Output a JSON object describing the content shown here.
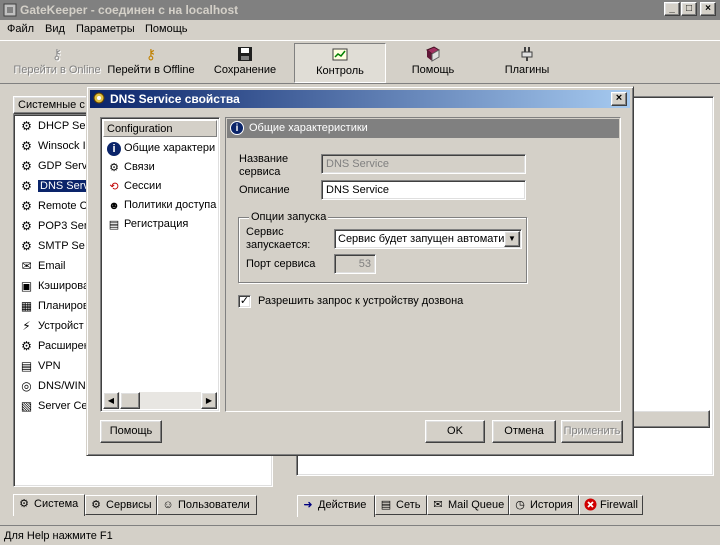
{
  "window": {
    "title": "GateKeeper - соединен с на localhost",
    "min": "_",
    "max": "□",
    "close": "×"
  },
  "menu": [
    "Файл",
    "Вид",
    "Параметры",
    "Помощь"
  ],
  "toolbar": {
    "go_online": "Перейти в Online",
    "go_offline": "Перейти в Offline",
    "save": "Сохранение",
    "control": "Контроль",
    "help": "Помощь",
    "plugins": "Плагины"
  },
  "left_pane": {
    "header": "Системные с",
    "items": [
      {
        "label": "DHCP Se",
        "icon": "⚙"
      },
      {
        "label": "Winsock I",
        "icon": "⚙"
      },
      {
        "label": "GDP Serv",
        "icon": "⚙"
      },
      {
        "label": "DNS Serv",
        "icon": "⚙",
        "selected": true
      },
      {
        "label": "Remote C",
        "icon": "⚙"
      },
      {
        "label": "POP3 Ser",
        "icon": "⚙"
      },
      {
        "label": "SMTP Se",
        "icon": "⚙"
      },
      {
        "label": "Email",
        "icon": "✉"
      },
      {
        "label": "Кэширова",
        "icon": "▣"
      },
      {
        "label": "Планиров",
        "icon": "▦"
      },
      {
        "label": "Устройст",
        "icon": "⚡"
      },
      {
        "label": "Расширен",
        "icon": "⚙"
      },
      {
        "label": "VPN",
        "icon": "▤"
      },
      {
        "label": "DNS/WIN",
        "icon": "◎"
      },
      {
        "label": "Server Ce",
        "icon": "▧"
      }
    ]
  },
  "bottom_tabs_left": [
    "Система",
    "Сервисы",
    "Пользователи"
  ],
  "bottom_tabs_right": [
    "Действие",
    "Сеть",
    "Mail Queue",
    "История",
    "Firewall"
  ],
  "status": "Для Help нажмите F1",
  "dialog": {
    "title": "DNS Service свойства",
    "close": "×",
    "nav_header": "Configuration",
    "nav_items": [
      "Общие характери",
      "Связи",
      "Сессии",
      "Политики доступа",
      "Регистрация"
    ],
    "section_title": "Общие характеристики",
    "service_name_label": "Название сервиса",
    "service_name_value": "DNS Service",
    "description_label": "Описание",
    "description_value": "DNS Service",
    "group_title": "Опции запуска",
    "start_label": "Сервис запускается:",
    "start_value": "Сервис будет запущен автомати",
    "port_label": "Порт сервиса",
    "port_value": "53",
    "checkbox_label": "Разрешить запрос к устройству дозвона",
    "checkbox_mark": "✓",
    "help_btn": "Помощь",
    "ok_btn": "OK",
    "cancel_btn": "Отмена",
    "apply_btn": "Применить"
  }
}
